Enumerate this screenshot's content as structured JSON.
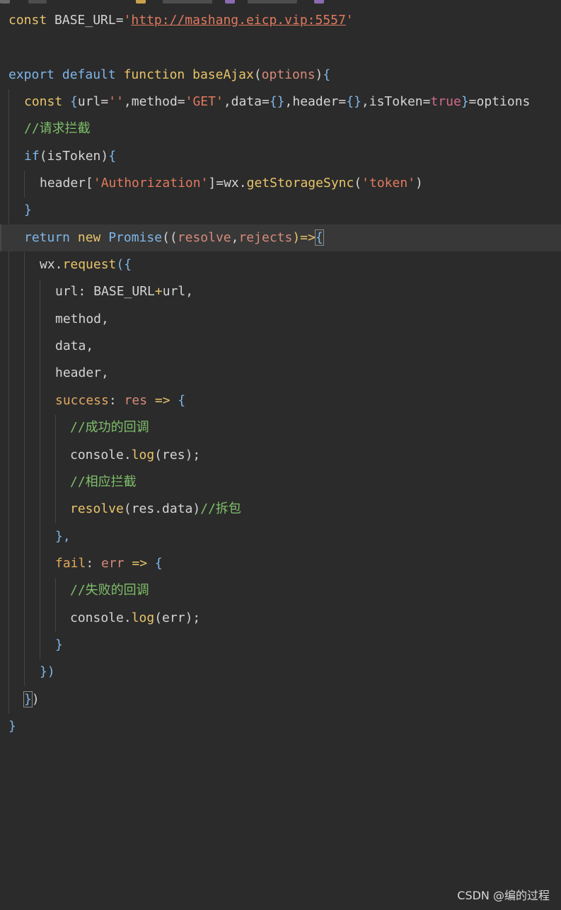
{
  "watermark": "CSDN @编的过程",
  "colors": {
    "background": "#2b2b2b",
    "keyword": "#e8c46a",
    "keyword_blue": "#7fb6e8",
    "string": "#e07a5f",
    "comment": "#7fbf6a",
    "property": "#e0a85f",
    "parameter": "#d68a7a",
    "plain": "#d4d4d4",
    "boolean": "#d46a8a",
    "current_line": "#383838"
  },
  "code": {
    "l1": {
      "const": "const",
      "name": " BASE_URL=",
      "quote_open": "'",
      "url": "http://mashang.eicp.vip:5557",
      "quote_close": "'"
    },
    "l3": {
      "export": "export",
      "default": " default ",
      "function": "function",
      "name": " baseAjax",
      "paren_open": "(",
      "param": "options",
      "paren_close": ")",
      "brace": "{"
    },
    "l4": {
      "const": "const",
      "brace_open": " {",
      "url_key": "url=",
      "url_val": "''",
      "method_key": ",method=",
      "method_val": "'GET'",
      "data_key": ",data=",
      "data_val": "{}",
      "header_key": ",header=",
      "header_val": "{}",
      "token_key": ",isToken=",
      "token_val": "true",
      "brace_close": "}",
      "rest": "=options"
    },
    "l5": {
      "comment": "//请求拦截"
    },
    "l6": {
      "if": "if",
      "cond": "(isToken)",
      "brace": "{"
    },
    "l7": {
      "header": "header[",
      "key": "'Authorization'",
      "assign": "]=wx.",
      "fn": "getStorageSync",
      "args_open": "(",
      "arg": "'token'",
      "args_close": ")"
    },
    "l8": {
      "brace": "}"
    },
    "l9": {
      "return": "return",
      "new": " new ",
      "promise": "Promise",
      "paren": "((",
      "resolve": "resolve",
      "comma": ",",
      "rejects": "rejects",
      "arrow": ")=>",
      "brace": "{"
    },
    "l10": {
      "wx": "wx.",
      "fn": "request",
      "open": "({"
    },
    "l11": {
      "key": "url",
      "colon": ": BASE_URL",
      "plus": "+",
      "rest": "url,"
    },
    "l12": {
      "text": "method,"
    },
    "l13": {
      "text": "data,"
    },
    "l14": {
      "text": "header,"
    },
    "l15": {
      "key": "success",
      "colon": ": ",
      "param": "res",
      "arrow": " => ",
      "brace": "{"
    },
    "l16": {
      "comment": "//成功的回调"
    },
    "l17": {
      "console": "console.",
      "fn": "log",
      "args": "(res);"
    },
    "l18": {
      "comment": "//相应拦截"
    },
    "l19": {
      "fn": "resolve",
      "args": "(res.data)",
      "comment": "//拆包"
    },
    "l20": {
      "text": "},"
    },
    "l21": {
      "key": "fail",
      "colon": ": ",
      "param": "err",
      "arrow": " => ",
      "brace": "{"
    },
    "l22": {
      "comment": "//失败的回调"
    },
    "l23": {
      "console": "console.",
      "fn": "log",
      "args": "(err);"
    },
    "l24": {
      "brace": "}"
    },
    "l25": {
      "text": "})"
    },
    "l26": {
      "brace": "}",
      "paren": ")"
    },
    "l27": {
      "brace": "}"
    }
  }
}
